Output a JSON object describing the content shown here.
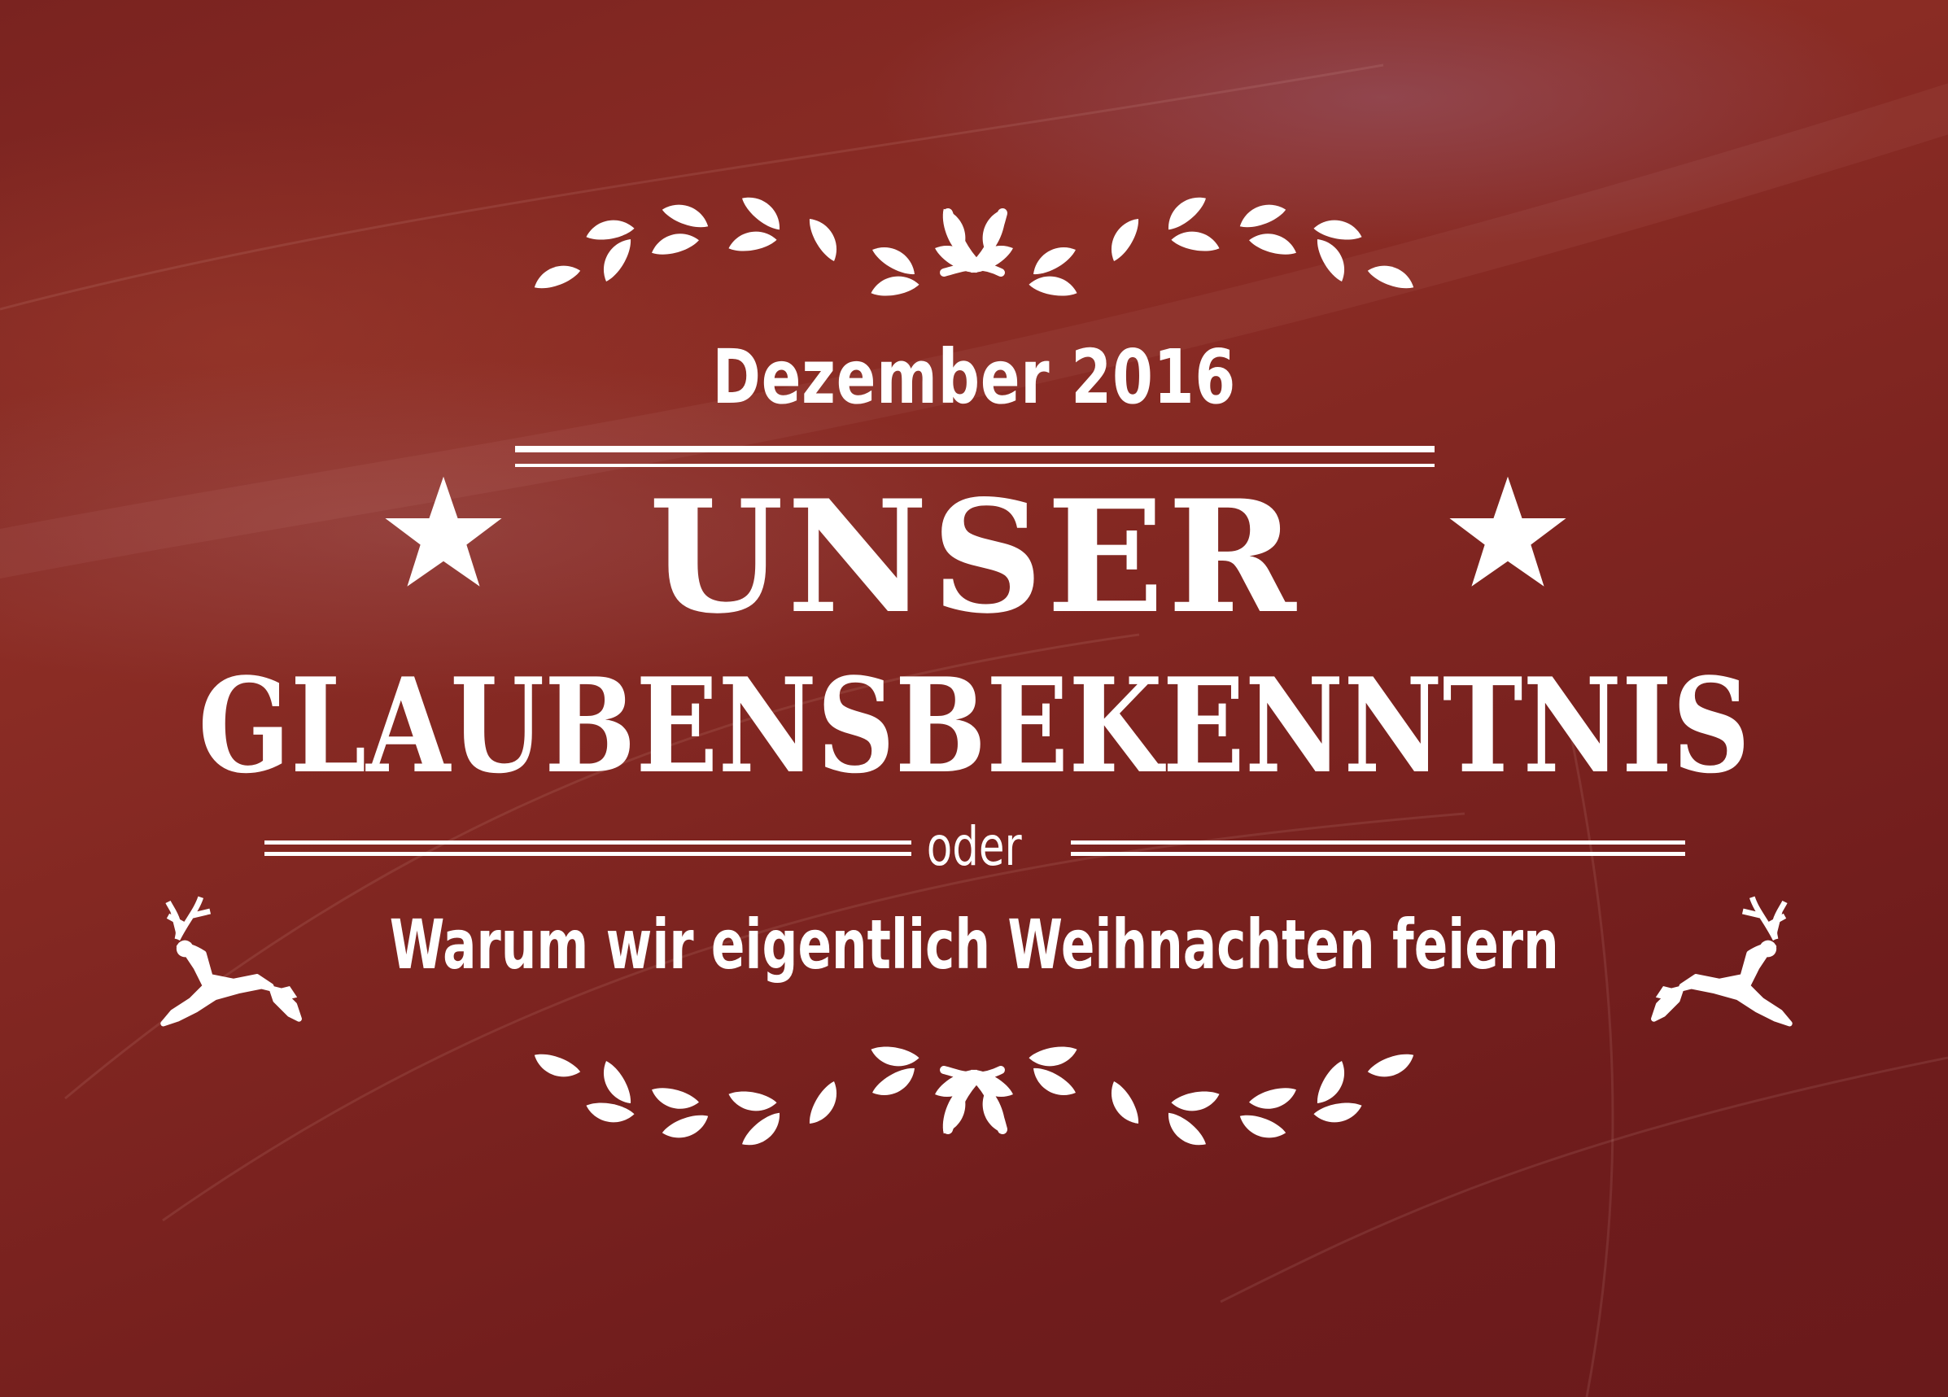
{
  "date": "Dezember 2016",
  "title": {
    "line1": "UNSER",
    "line2": "GLAUBENSBEKENNTNIS"
  },
  "connector": "oder",
  "subtitle": "Warum wir eigentlich Weihnachten feiern",
  "colors": {
    "background": "#7d2420",
    "foreground": "#ffffff"
  },
  "icons": {
    "top_ornament": "laurel-branch-icon",
    "bottom_ornament": "laurel-branch-icon",
    "stars": "star-icon",
    "deer": "leaping-deer-icon"
  }
}
